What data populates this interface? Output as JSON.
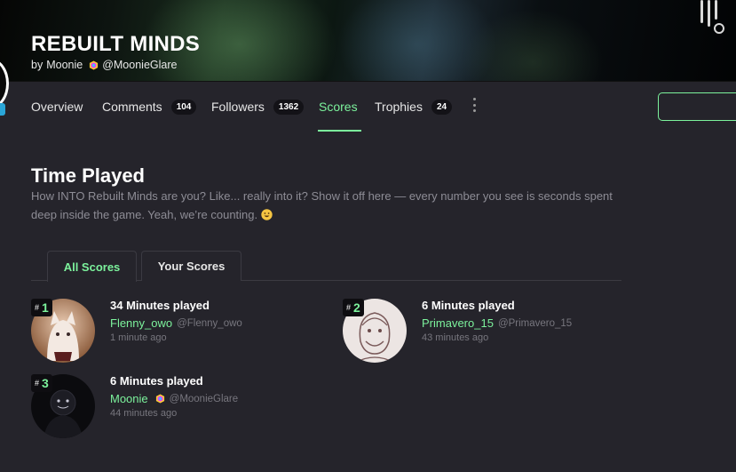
{
  "header": {
    "title": "REBUILT MINDS",
    "by_label": "by",
    "author_name": "Moonie",
    "author_handle": "@MoonieGlare"
  },
  "nav": {
    "overview": "Overview",
    "comments": "Comments",
    "comments_count": "104",
    "followers": "Followers",
    "followers_count": "1362",
    "scores": "Scores",
    "trophies": "Trophies",
    "trophies_count": "24",
    "active": "Scores"
  },
  "section": {
    "title": "Time Played",
    "description": "How INTO Rebuilt Minds are you? Like... really into it? Show it off here — every number you see is seconds spent deep inside the game. Yeah, we’re counting."
  },
  "tabs": {
    "all_scores": "All Scores",
    "your_scores": "Your Scores",
    "active": "All Scores"
  },
  "scores": [
    {
      "rank_symbol": "#",
      "rank": "1",
      "value": "34 Minutes played",
      "username": "Flenny_owo",
      "handle": "@Flenny_owo",
      "time_ago": "1 minute ago",
      "verified": false
    },
    {
      "rank_symbol": "#",
      "rank": "2",
      "value": "6 Minutes played",
      "username": "Primavero_15",
      "handle": "@Primavero_15",
      "time_ago": "43 minutes ago",
      "verified": false
    },
    {
      "rank_symbol": "#",
      "rank": "3",
      "value": "6 Minutes played",
      "username": "Moonie",
      "handle": "@MoonieGlare",
      "time_ago": "44 minutes ago",
      "verified": true
    }
  ],
  "colors": {
    "accent": "#7cf29c",
    "background": "#25242b",
    "muted_text": "#8d8c95"
  },
  "icons": {
    "verified": "hexagon-badge-icon",
    "more": "kebab-menu-icon",
    "emoji": "grinning-face-emoji"
  }
}
